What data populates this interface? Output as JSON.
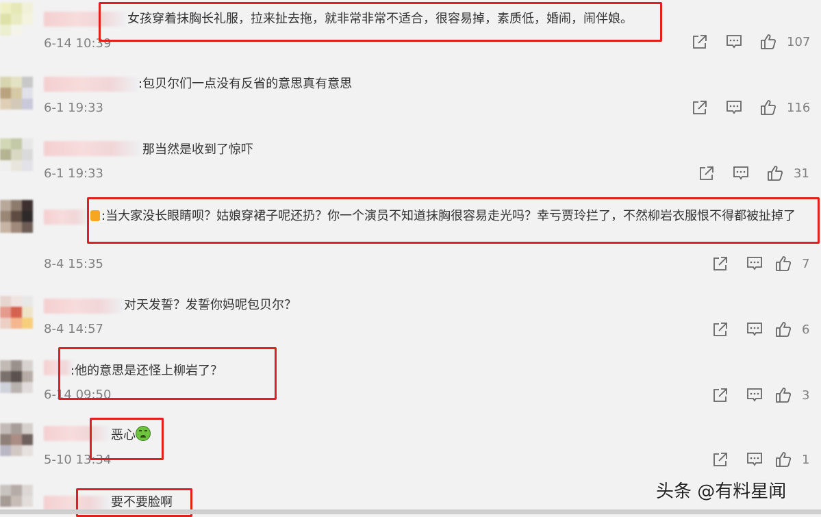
{
  "comments": [
    {
      "text": "女孩穿着抹胸长礼服，拉来扯去拖，就非常非常不适合，很容易掉，素质低，婚闹，闹伴娘。",
      "time": "6-14 10:39",
      "likes": "107"
    },
    {
      "text": ":包贝尔们一点没有反省的意思真有意思",
      "time": "6-1 19:33",
      "likes": "116"
    },
    {
      "text": "那当然是收到了惊吓",
      "time": "6-1 19:33",
      "likes": "31"
    },
    {
      "text": ":当大家没长眼睛呗？姑娘穿裙子呢还扔？你一个演员不知道抹胸很容易走光吗？幸亏贾玲拦了，不然柳岩衣服恨不得都被扯掉了",
      "time": "8-4 15:35",
      "likes": "7"
    },
    {
      "text": "对天发誓？发誓你妈呢包贝尔？",
      "time": "8-4 14:57",
      "likes": "6"
    },
    {
      "text": ":他的意思是还怪上柳岩了？",
      "time": "6-14 09:50",
      "likes": "3"
    },
    {
      "text": "恶心",
      "time": "5-10 13:34",
      "likes": "1"
    },
    {
      "text": "要不要脸啊",
      "time": "",
      "likes": ""
    }
  ],
  "icons": {
    "share": "share-icon",
    "reply": "comment-icon",
    "like": "thumbs-up-icon"
  },
  "watermark": "头条 @有料星闻",
  "colors": {
    "highlight_box": "#e0201c",
    "meta_text": "#808080"
  }
}
